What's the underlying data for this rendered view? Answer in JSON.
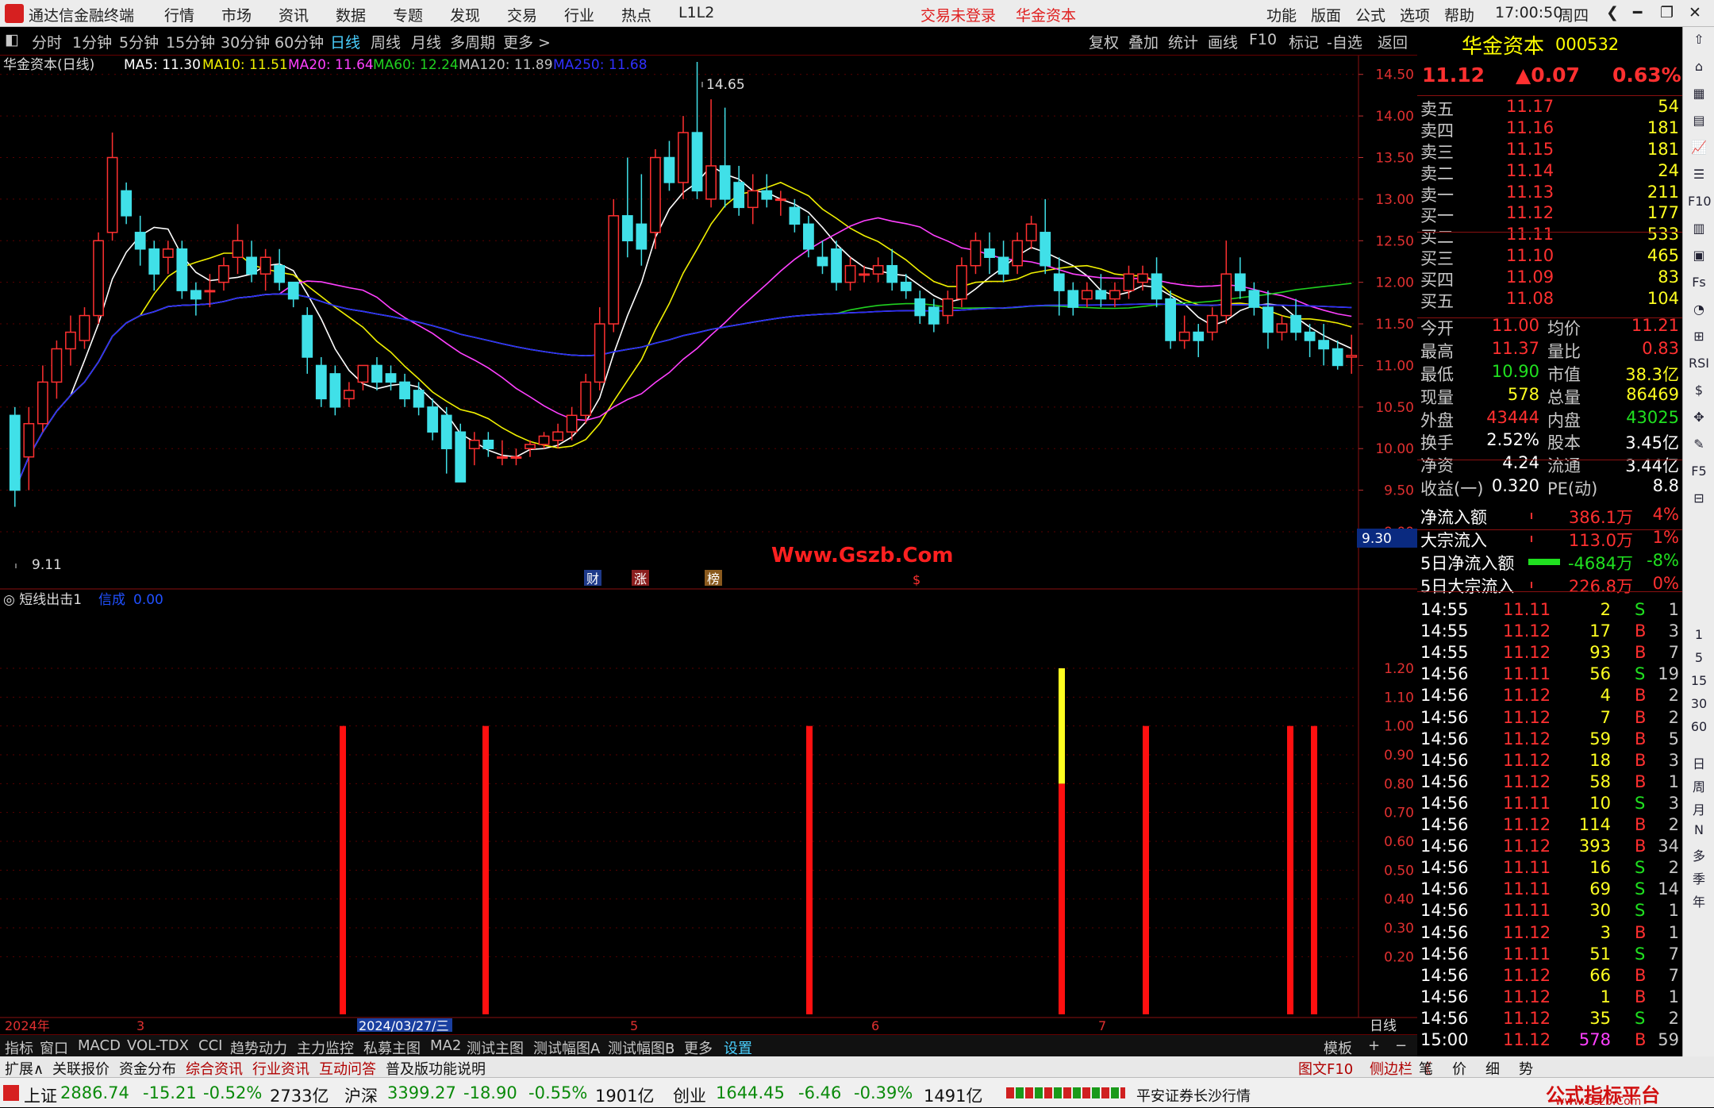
{
  "titlebar": {
    "app_name": "通达信金融终端",
    "menu": [
      "行情",
      "市场",
      "资讯",
      "数据",
      "专题",
      "发现",
      "交易",
      "行业",
      "热点",
      "L1L2"
    ],
    "trade_status": "交易未登录",
    "stock_name": "华金资本",
    "right_menu": [
      "功能",
      "版面",
      "公式",
      "选项",
      "帮助"
    ],
    "time": "17:00:50",
    "weekday": "周四"
  },
  "periodbar": {
    "periods": [
      "分时",
      "1分钟",
      "5分钟",
      "15分钟",
      "30分钟",
      "60分钟",
      "日线",
      "周线",
      "月线",
      "多周期",
      "更多 >"
    ],
    "active": "日线",
    "tools": [
      "复权",
      "叠加",
      "统计",
      "画线",
      "F10",
      "标记",
      "-自选",
      "返回"
    ]
  },
  "main_chart": {
    "header": "华金资本(日线)",
    "ma": [
      {
        "label": "MA5: 11.30",
        "color": "#ffffff"
      },
      {
        "label": "MA10: 11.51",
        "color": "#f0f000"
      },
      {
        "label": "MA20: 11.64",
        "color": "#ff40ff"
      },
      {
        "label": "MA60: 12.24",
        "color": "#20d020"
      },
      {
        "label": "MA120: 11.89",
        "color": "#c0c0c0"
      },
      {
        "label": "MA250: 11.68",
        "color": "#2020ff"
      }
    ],
    "high_label": "14.65",
    "low_label": "9.11",
    "last_price_tag": "9.30",
    "watermark": "Www.Gszb.Com",
    "markers": [
      "财",
      "涨",
      "榜",
      "$"
    ],
    "y_ticks": [
      "14.50",
      "14.00",
      "13.50",
      "13.00",
      "12.50",
      "12.00",
      "11.50",
      "11.00",
      "10.50",
      "10.00",
      "9.50",
      "9.00"
    ]
  },
  "chart_data": [
    {
      "type": "candlestick",
      "title": "华金资本(日线)",
      "ylim": [
        9.0,
        14.65
      ],
      "ohlc": [
        [
          10.4,
          10.5,
          9.3,
          9.5
        ],
        [
          9.9,
          10.5,
          9.5,
          10.3
        ],
        [
          10.3,
          11.0,
          10.2,
          10.8
        ],
        [
          10.8,
          11.3,
          10.6,
          11.2
        ],
        [
          11.2,
          11.6,
          11.0,
          11.4
        ],
        [
          11.3,
          11.7,
          11.2,
          11.6
        ],
        [
          11.6,
          12.6,
          11.5,
          12.5
        ],
        [
          12.6,
          13.8,
          12.5,
          13.5
        ],
        [
          13.1,
          13.2,
          12.7,
          12.8
        ],
        [
          12.6,
          12.8,
          12.2,
          12.4
        ],
        [
          12.4,
          12.5,
          11.9,
          12.1
        ],
        [
          12.3,
          12.5,
          12.1,
          12.4
        ],
        [
          12.4,
          12.5,
          11.8,
          11.9
        ],
        [
          11.9,
          12.0,
          11.6,
          11.8
        ],
        [
          11.9,
          12.1,
          11.7,
          11.9
        ],
        [
          12.0,
          12.3,
          11.9,
          12.2
        ],
        [
          12.3,
          12.7,
          12.1,
          12.5
        ],
        [
          12.3,
          12.5,
          12.0,
          12.1
        ],
        [
          12.1,
          12.4,
          11.9,
          12.3
        ],
        [
          12.2,
          12.4,
          11.9,
          12.0
        ],
        [
          12.0,
          12.0,
          11.7,
          11.8
        ],
        [
          11.6,
          11.7,
          10.9,
          11.1
        ],
        [
          11.0,
          11.1,
          10.5,
          10.6
        ],
        [
          10.9,
          11.0,
          10.4,
          10.5
        ],
        [
          10.6,
          10.8,
          10.5,
          10.7
        ],
        [
          10.8,
          11.0,
          10.7,
          11.0
        ],
        [
          11.0,
          11.1,
          10.7,
          10.8
        ],
        [
          10.9,
          11.0,
          10.7,
          10.8
        ],
        [
          10.8,
          10.9,
          10.5,
          10.6
        ],
        [
          10.7,
          10.8,
          10.4,
          10.5
        ],
        [
          10.5,
          10.6,
          10.1,
          10.2
        ],
        [
          10.4,
          10.5,
          9.7,
          10.0
        ],
        [
          10.2,
          10.3,
          9.6,
          9.6
        ],
        [
          10.0,
          10.2,
          9.8,
          10.1
        ],
        [
          10.1,
          10.2,
          9.9,
          10.0
        ],
        [
          9.9,
          10.1,
          9.8,
          9.9
        ],
        [
          9.9,
          10.0,
          9.8,
          9.9
        ],
        [
          10.0,
          10.1,
          9.9,
          10.05
        ],
        [
          10.05,
          10.2,
          10.0,
          10.15
        ],
        [
          10.1,
          10.3,
          10.0,
          10.2
        ],
        [
          10.2,
          10.5,
          10.1,
          10.4
        ],
        [
          10.4,
          10.9,
          10.3,
          10.8
        ],
        [
          10.8,
          11.7,
          10.7,
          11.5
        ],
        [
          11.5,
          13.0,
          11.4,
          12.8
        ],
        [
          12.8,
          13.5,
          12.3,
          12.5
        ],
        [
          12.7,
          13.3,
          12.2,
          12.4
        ],
        [
          12.6,
          13.6,
          12.4,
          13.5
        ],
        [
          13.5,
          13.7,
          13.1,
          13.2
        ],
        [
          13.2,
          14.0,
          13.0,
          13.8
        ],
        [
          13.8,
          14.65,
          13.0,
          13.1
        ],
        [
          13.0,
          14.2,
          12.9,
          13.4
        ],
        [
          13.4,
          14.1,
          12.9,
          13.0
        ],
        [
          13.2,
          13.4,
          12.8,
          12.9
        ],
        [
          12.9,
          13.3,
          12.7,
          13.1
        ],
        [
          13.1,
          13.3,
          12.9,
          13.0
        ],
        [
          13.0,
          13.1,
          12.8,
          13.0
        ],
        [
          12.9,
          13.0,
          12.6,
          12.7
        ],
        [
          12.7,
          12.8,
          12.3,
          12.4
        ],
        [
          12.3,
          12.5,
          12.1,
          12.2
        ],
        [
          12.4,
          12.5,
          11.9,
          12.0
        ],
        [
          12.0,
          12.3,
          11.9,
          12.2
        ],
        [
          12.1,
          12.2,
          12.0,
          12.1
        ],
        [
          12.1,
          12.3,
          12.0,
          12.2
        ],
        [
          12.2,
          12.4,
          11.9,
          12.0
        ],
        [
          12.0,
          12.1,
          11.8,
          11.9
        ],
        [
          11.8,
          11.9,
          11.5,
          11.6
        ],
        [
          11.7,
          11.8,
          11.4,
          11.5
        ],
        [
          11.6,
          11.9,
          11.5,
          11.8
        ],
        [
          11.8,
          12.3,
          11.7,
          12.2
        ],
        [
          12.2,
          12.6,
          12.1,
          12.5
        ],
        [
          12.4,
          12.6,
          12.1,
          12.3
        ],
        [
          12.3,
          12.5,
          12.0,
          12.1
        ],
        [
          12.2,
          12.6,
          12.1,
          12.5
        ],
        [
          12.5,
          12.8,
          12.4,
          12.7
        ],
        [
          12.6,
          13.0,
          12.1,
          12.2
        ],
        [
          12.1,
          12.3,
          11.6,
          11.9
        ],
        [
          11.9,
          12.0,
          11.6,
          11.7
        ],
        [
          11.8,
          12.0,
          11.7,
          11.9
        ],
        [
          11.9,
          12.1,
          11.7,
          11.8
        ],
        [
          11.8,
          12.0,
          11.7,
          11.9
        ],
        [
          11.9,
          12.2,
          11.8,
          12.1
        ],
        [
          12.0,
          12.2,
          11.9,
          12.1
        ],
        [
          12.1,
          12.3,
          11.7,
          11.8
        ],
        [
          11.8,
          11.9,
          11.2,
          11.3
        ],
        [
          11.3,
          11.6,
          11.2,
          11.4
        ],
        [
          11.4,
          11.5,
          11.1,
          11.3
        ],
        [
          11.4,
          11.7,
          11.3,
          11.6
        ],
        [
          11.6,
          12.5,
          11.5,
          12.1
        ],
        [
          12.1,
          12.3,
          11.8,
          11.9
        ],
        [
          11.9,
          12.0,
          11.6,
          11.7
        ],
        [
          11.7,
          11.9,
          11.2,
          11.4
        ],
        [
          11.4,
          11.6,
          11.3,
          11.5
        ],
        [
          11.6,
          11.8,
          11.3,
          11.4
        ],
        [
          11.4,
          11.5,
          11.1,
          11.3
        ],
        [
          11.3,
          11.5,
          11.0,
          11.2
        ],
        [
          11.2,
          11.3,
          10.95,
          11.0
        ],
        [
          11.1,
          11.37,
          10.9,
          11.12
        ]
      ]
    },
    {
      "type": "bar",
      "title": "短线出击1",
      "series": [
        {
          "name": "",
          "values": [
            1,
            1,
            1,
            1.2,
            1,
            1,
            1
          ]
        }
      ],
      "ylim": [
        0,
        1.2
      ]
    }
  ],
  "sub_chart": {
    "title": "短线出击1",
    "sub_label": "信成",
    "sub_value": "0.00",
    "y_ticks": [
      "1.20",
      "1.10",
      "1.00",
      "0.90",
      "0.80",
      "0.70",
      "0.60",
      "0.50",
      "0.40",
      "0.30",
      "0.20"
    ],
    "x_labels": [
      "2024年",
      "3",
      "2024/03/27/三",
      "5",
      "6",
      "7"
    ],
    "right_label": "日线"
  },
  "tabbar": {
    "tabs": [
      "指标",
      "窗口",
      "MACD",
      "VOL-TDX",
      "CCI",
      "趋势动力",
      "主力监控",
      "私募主图",
      "MA2",
      "测试主图",
      "测试幅图A",
      "测试幅图B",
      "更多",
      "设置"
    ],
    "right": [
      "模板",
      "+",
      "−"
    ]
  },
  "extbar": {
    "items": [
      "扩展∧",
      "关联报价",
      "资金分布",
      "综合资讯",
      "行业资讯",
      "互动问答",
      "普及版功能说明"
    ],
    "right": [
      "图文F10",
      "侧边栏 《",
      "笔",
      "价",
      "细",
      "势"
    ]
  },
  "quote": {
    "name": "华金资本",
    "code": "000532",
    "price": "11.12",
    "change": "▲0.07",
    "pct": "0.63%",
    "asks": [
      [
        "卖五",
        "11.17",
        "54"
      ],
      [
        "卖四",
        "11.16",
        "181"
      ],
      [
        "卖三",
        "11.15",
        "181"
      ],
      [
        "卖二",
        "11.14",
        "24"
      ],
      [
        "卖一",
        "11.13",
        "211"
      ]
    ],
    "bids": [
      [
        "买一",
        "11.12",
        "177"
      ],
      [
        "买二",
        "11.11",
        "533"
      ],
      [
        "买三",
        "11.10",
        "465"
      ],
      [
        "买四",
        "11.09",
        "83"
      ],
      [
        "买五",
        "11.08",
        "104"
      ]
    ],
    "stats": [
      [
        "今开",
        "11.00",
        "均价",
        "11.21"
      ],
      [
        "最高",
        "11.37",
        "量比",
        "0.83"
      ],
      [
        "最低",
        "10.90",
        "市值",
        "38.3亿"
      ],
      [
        "现量",
        "578",
        "总量",
        "86469"
      ],
      [
        "外盘",
        "43444",
        "内盘",
        "43025"
      ]
    ],
    "stats2": [
      [
        "换手",
        "2.52%",
        "股本",
        "3.45亿"
      ],
      [
        "净资",
        "4.24",
        "流通",
        "3.44亿"
      ],
      [
        "收益(一)",
        "0.320",
        "PE(动)",
        "8.8"
      ]
    ],
    "flows": [
      [
        "净流入额",
        "386.1万",
        "4%"
      ],
      [
        "大宗流入",
        "113.0万",
        "1%"
      ],
      [
        "5日净流入额",
        "-4684万",
        "-8%"
      ],
      [
        "5日大宗流入",
        "226.8万",
        "0%"
      ]
    ],
    "ticks": [
      [
        "14:55",
        "11.11",
        "2",
        "S",
        "1"
      ],
      [
        "14:55",
        "11.12",
        "17",
        "B",
        "3"
      ],
      [
        "14:55",
        "11.12",
        "93",
        "B",
        "7"
      ],
      [
        "14:56",
        "11.11",
        "56",
        "S",
        "19"
      ],
      [
        "14:56",
        "11.12",
        "4",
        "B",
        "2"
      ],
      [
        "14:56",
        "11.12",
        "7",
        "B",
        "2"
      ],
      [
        "14:56",
        "11.12",
        "59",
        "B",
        "5"
      ],
      [
        "14:56",
        "11.12",
        "18",
        "B",
        "3"
      ],
      [
        "14:56",
        "11.12",
        "58",
        "B",
        "1"
      ],
      [
        "14:56",
        "11.11",
        "10",
        "S",
        "3"
      ],
      [
        "14:56",
        "11.12",
        "114",
        "B",
        "2"
      ],
      [
        "14:56",
        "11.12",
        "393",
        "B",
        "34"
      ],
      [
        "14:56",
        "11.11",
        "16",
        "S",
        "2"
      ],
      [
        "14:56",
        "11.11",
        "69",
        "S",
        "14"
      ],
      [
        "14:56",
        "11.11",
        "30",
        "S",
        "1"
      ],
      [
        "14:56",
        "11.12",
        "3",
        "B",
        "1"
      ],
      [
        "14:56",
        "11.11",
        "51",
        "S",
        "7"
      ],
      [
        "14:56",
        "11.12",
        "66",
        "B",
        "7"
      ],
      [
        "14:56",
        "11.12",
        "1",
        "B",
        "1"
      ],
      [
        "14:56",
        "11.12",
        "35",
        "S",
        "2"
      ],
      [
        "15:00",
        "11.12",
        "578",
        "B",
        "59"
      ]
    ]
  },
  "sidebar": {
    "items": [
      "1",
      "5",
      "15",
      "30",
      "60",
      "日",
      "周",
      "月",
      "N",
      "多",
      "季",
      "年"
    ]
  },
  "statusbar": {
    "indices": [
      {
        "name": "上证",
        "val": "2886.74",
        "chg": "-15.21",
        "pct": "-0.52%",
        "amt": "2733亿"
      },
      {
        "name": "沪深",
        "val": "3399.27",
        "chg": "-18.90",
        "pct": "-0.55%",
        "amt": "1901亿"
      },
      {
        "name": "创业",
        "val": "1644.45",
        "chg": "-6.46",
        "pct": "-0.39%",
        "amt": "1491亿"
      }
    ],
    "broker": "平安证券长沙行情",
    "watermark": "公式指标平台",
    "watermark_url": "www.Gszb.Com"
  }
}
